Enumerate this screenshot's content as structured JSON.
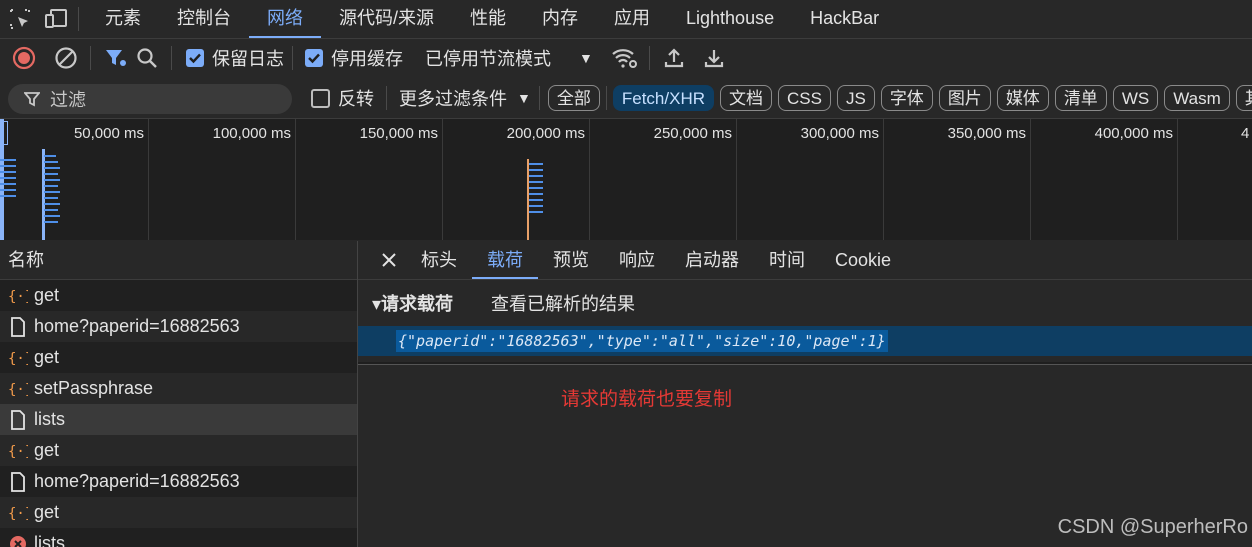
{
  "top_tabs": [
    {
      "label": "元素",
      "active": false
    },
    {
      "label": "控制台",
      "active": false
    },
    {
      "label": "网络",
      "active": true
    },
    {
      "label": "源代码/来源",
      "active": false
    },
    {
      "label": "性能",
      "active": false
    },
    {
      "label": "内存",
      "active": false
    },
    {
      "label": "应用",
      "active": false
    },
    {
      "label": "Lighthouse",
      "active": false
    },
    {
      "label": "HackBar",
      "active": false
    }
  ],
  "toolbar": {
    "preserve_log": "保留日志",
    "disable_cache": "停用缓存",
    "throttle": "已停用节流模式"
  },
  "filter": {
    "placeholder": "过滤",
    "invert": "反转",
    "more_filters": "更多过滤条件",
    "types": [
      {
        "label": "全部",
        "active": false
      },
      {
        "label": "Fetch/XHR",
        "active": true
      },
      {
        "label": "文档",
        "active": false
      },
      {
        "label": "CSS",
        "active": false
      },
      {
        "label": "JS",
        "active": false
      },
      {
        "label": "字体",
        "active": false
      },
      {
        "label": "图片",
        "active": false
      },
      {
        "label": "媒体",
        "active": false
      },
      {
        "label": "清单",
        "active": false
      },
      {
        "label": "WS",
        "active": false
      },
      {
        "label": "Wasm",
        "active": false
      },
      {
        "label": "其",
        "active": false
      }
    ]
  },
  "timeline": {
    "ticks": [
      "50,000 ms",
      "100,000 ms",
      "150,000 ms",
      "200,000 ms",
      "250,000 ms",
      "300,000 ms",
      "350,000 ms",
      "400,000 ms",
      "4"
    ]
  },
  "name_panel": {
    "header": "名称",
    "requests": [
      {
        "name": "get",
        "icon": "xhr-icon"
      },
      {
        "name": "home?paperid=16882563",
        "icon": "document-icon"
      },
      {
        "name": "get",
        "icon": "xhr-icon"
      },
      {
        "name": "setPassphrase",
        "icon": "xhr-icon"
      },
      {
        "name": "lists",
        "icon": "document-icon"
      },
      {
        "name": "get",
        "icon": "xhr-icon"
      },
      {
        "name": "home?paperid=16882563",
        "icon": "document-icon"
      },
      {
        "name": "get",
        "icon": "xhr-icon"
      },
      {
        "name": "lists",
        "icon": "error-icon"
      }
    ]
  },
  "detail": {
    "tabs": [
      {
        "label": "标头",
        "active": false
      },
      {
        "label": "载荷",
        "active": true
      },
      {
        "label": "预览",
        "active": false
      },
      {
        "label": "响应",
        "active": false
      },
      {
        "label": "启动器",
        "active": false
      },
      {
        "label": "时间",
        "active": false
      },
      {
        "label": "Cookie",
        "active": false
      }
    ],
    "section_title": "▾请求载荷",
    "view_parsed": "查看已解析的结果",
    "payload": "{\"paperid\":\"16882563\",\"type\":\"all\",\"size\":10,\"page\":1}"
  },
  "annotation": "请求的载荷也要复制",
  "watermark": "CSDN @SuperherRo",
  "colors": {
    "accent": "#7cacf8",
    "record": "#e46962",
    "selection": "#0e3e63",
    "annotation": "#e53935"
  }
}
